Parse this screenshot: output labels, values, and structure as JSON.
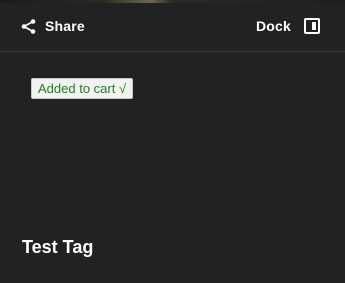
{
  "toolbar": {
    "share_label": "Share",
    "dock_label": "Dock",
    "share_icon": "share-icon",
    "dock_icon": "dock-panel-icon"
  },
  "cart": {
    "status_text": "Added to cart √",
    "status_color": "#22801e"
  },
  "content": {
    "title": "Test Tag"
  },
  "colors": {
    "background": "#222222",
    "text": "#ffffff",
    "divider": "#3a3a3a"
  }
}
